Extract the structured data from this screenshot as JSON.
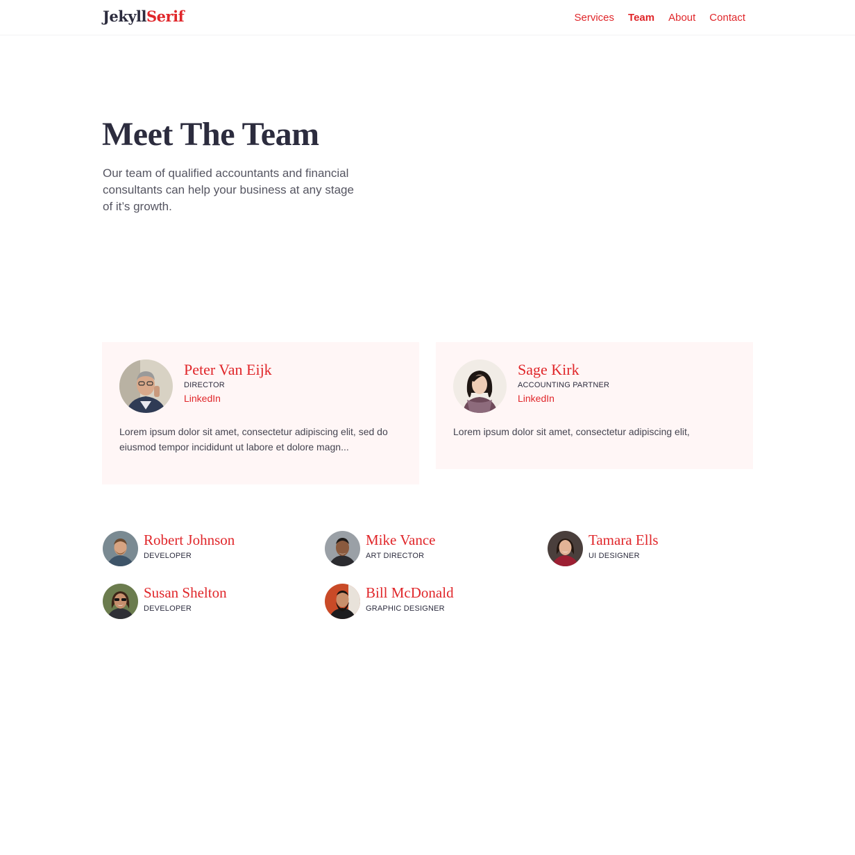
{
  "header": {
    "logo_part1": "Jekyll",
    "logo_part2": "Serif",
    "nav": [
      {
        "label": "Services"
      },
      {
        "label": "Team",
        "active": true
      },
      {
        "label": "About"
      },
      {
        "label": "Contact"
      }
    ]
  },
  "hero": {
    "title": "Meet The Team",
    "text": "Our team of qualified accountants and financial consultants can help your business at any stage of it’s growth."
  },
  "featured": [
    {
      "name": "Peter Van Eijk",
      "role": "DIRECTOR",
      "link": "LinkedIn",
      "bio": "Lorem ipsum dolor sit amet, consectetur adipiscing elit, sed do eiusmod tempor incididunt ut labore et dolore magn..."
    },
    {
      "name": "Sage Kirk",
      "role": "ACCOUNTING PARTNER",
      "link": "LinkedIn",
      "bio": "Lorem ipsum dolor sit amet, consectetur adipiscing elit,"
    }
  ],
  "members": [
    {
      "name": "Robert Johnson",
      "role": "DEVELOPER"
    },
    {
      "name": "Mike Vance",
      "role": "ART DIRECTOR"
    },
    {
      "name": "Tamara Ells",
      "role": "UI DESIGNER"
    },
    {
      "name": "Susan Shelton",
      "role": "DEVELOPER"
    },
    {
      "name": "Bill McDonald",
      "role": "GRAPHIC DESIGNER"
    }
  ],
  "colors": {
    "accent": "#e0262a",
    "heading": "#2c2c3e",
    "card_bg": "#fff6f6"
  }
}
